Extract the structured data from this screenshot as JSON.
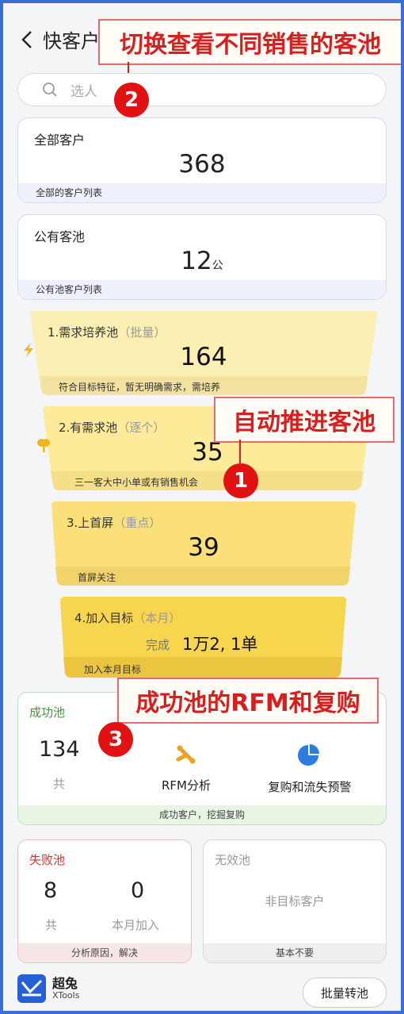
{
  "header": {
    "title": "快客户"
  },
  "search": {
    "placeholder": "选人"
  },
  "annotations": [
    {
      "num": "2",
      "text": "切换查看不同销售的客池"
    },
    {
      "num": "1",
      "text": "自动推进客池"
    },
    {
      "num": "3",
      "text": "成功池的RFM和复购"
    }
  ],
  "all_customers": {
    "label": "全部客户",
    "count": "368",
    "footer": "全部的客户列表"
  },
  "public_pool": {
    "label": "公有客池",
    "count": "12",
    "unit": "公",
    "footer": "公有池客户列表"
  },
  "funnel": [
    {
      "label": "1.需求培养池",
      "tag": "（批量）",
      "value": "164",
      "footer": "符合目标特征，暂无明确需求，需培养",
      "icon": "lightning-icon",
      "color": "#fcefb4"
    },
    {
      "label": "2.有需求池",
      "tag": "（逐个）",
      "value": "35",
      "footer": "三一客大中小单或有销售机会",
      "icon": "sprout-icon",
      "color": "#fdeb9a"
    },
    {
      "label": "3.上首屏",
      "tag": "（重点）",
      "value": "39",
      "footer": "首屏关注",
      "color": "#fbe07a"
    },
    {
      "label": "4.加入目标",
      "tag": "（本月）",
      "done_label": "完成",
      "value": "1万2, 1单",
      "footer": "加入本月目标",
      "color": "#f8d54e"
    }
  ],
  "success_pool": {
    "title": "成功池",
    "count": "134",
    "count_label": "共",
    "rfm_label": "RFM分析",
    "repurchase_label": "复购和流失预警",
    "footer": "成功客户，挖掘复购",
    "title_color": "#3a9a3a"
  },
  "fail_pool": {
    "title": "失败池",
    "total": "8",
    "total_label": "共",
    "month": "0",
    "month_label": "本月加入",
    "footer": "分析原因，解决",
    "title_color": "#d93030"
  },
  "invalid_pool": {
    "title": "无效池",
    "desc": "非目标客户",
    "footer": "基本不要"
  },
  "brand": {
    "name": "超兔",
    "sub": "XTools"
  },
  "batch_button": "批量转池"
}
